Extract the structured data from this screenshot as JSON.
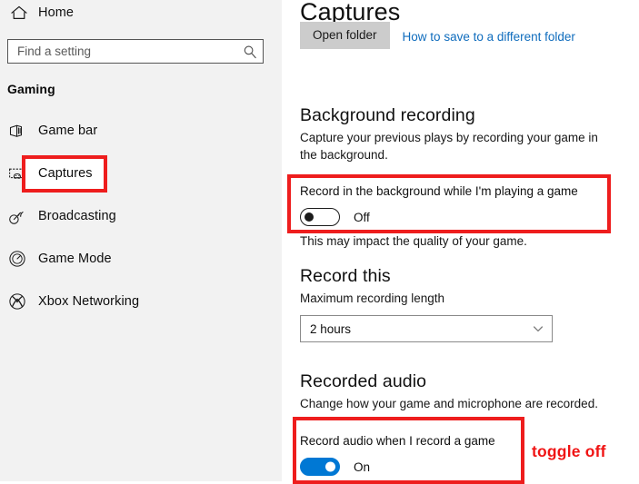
{
  "sidebar": {
    "home": {
      "label": "Home",
      "icon": "home-icon"
    },
    "search": {
      "placeholder": "Find a setting",
      "value": "",
      "icon": "search-icon"
    },
    "category_title": "Gaming",
    "items": [
      {
        "label": "Game bar",
        "icon": "game-bar-icon",
        "selected": false
      },
      {
        "label": "Captures",
        "icon": "captures-icon",
        "selected": true
      },
      {
        "label": "Broadcasting",
        "icon": "broadcasting-icon",
        "selected": false
      },
      {
        "label": "Game Mode",
        "icon": "game-mode-icon",
        "selected": false
      },
      {
        "label": "Xbox Networking",
        "icon": "xbox-icon",
        "selected": false
      }
    ]
  },
  "main": {
    "title": "Captures",
    "open_folder_button": "Open folder",
    "folder_link": "How to save to a different folder",
    "background_recording": {
      "heading": "Background recording",
      "description": "Capture your previous plays by recording your game in the background.",
      "setting_label": "Record in the background while I'm playing a game",
      "toggle_state": "Off",
      "toggle_on": false,
      "note": "This may impact the quality of your game."
    },
    "record_this": {
      "heading": "Record this",
      "label": "Maximum recording length",
      "dropdown_value": "2 hours"
    },
    "recorded_audio": {
      "heading": "Recorded audio",
      "description": "Change how your game and microphone are recorded.",
      "setting_label": "Record audio when I record a game",
      "toggle_state": "On",
      "toggle_on": true
    }
  },
  "annotations": {
    "toggle_off_text": "toggle off",
    "color": "#ee1d1d"
  }
}
